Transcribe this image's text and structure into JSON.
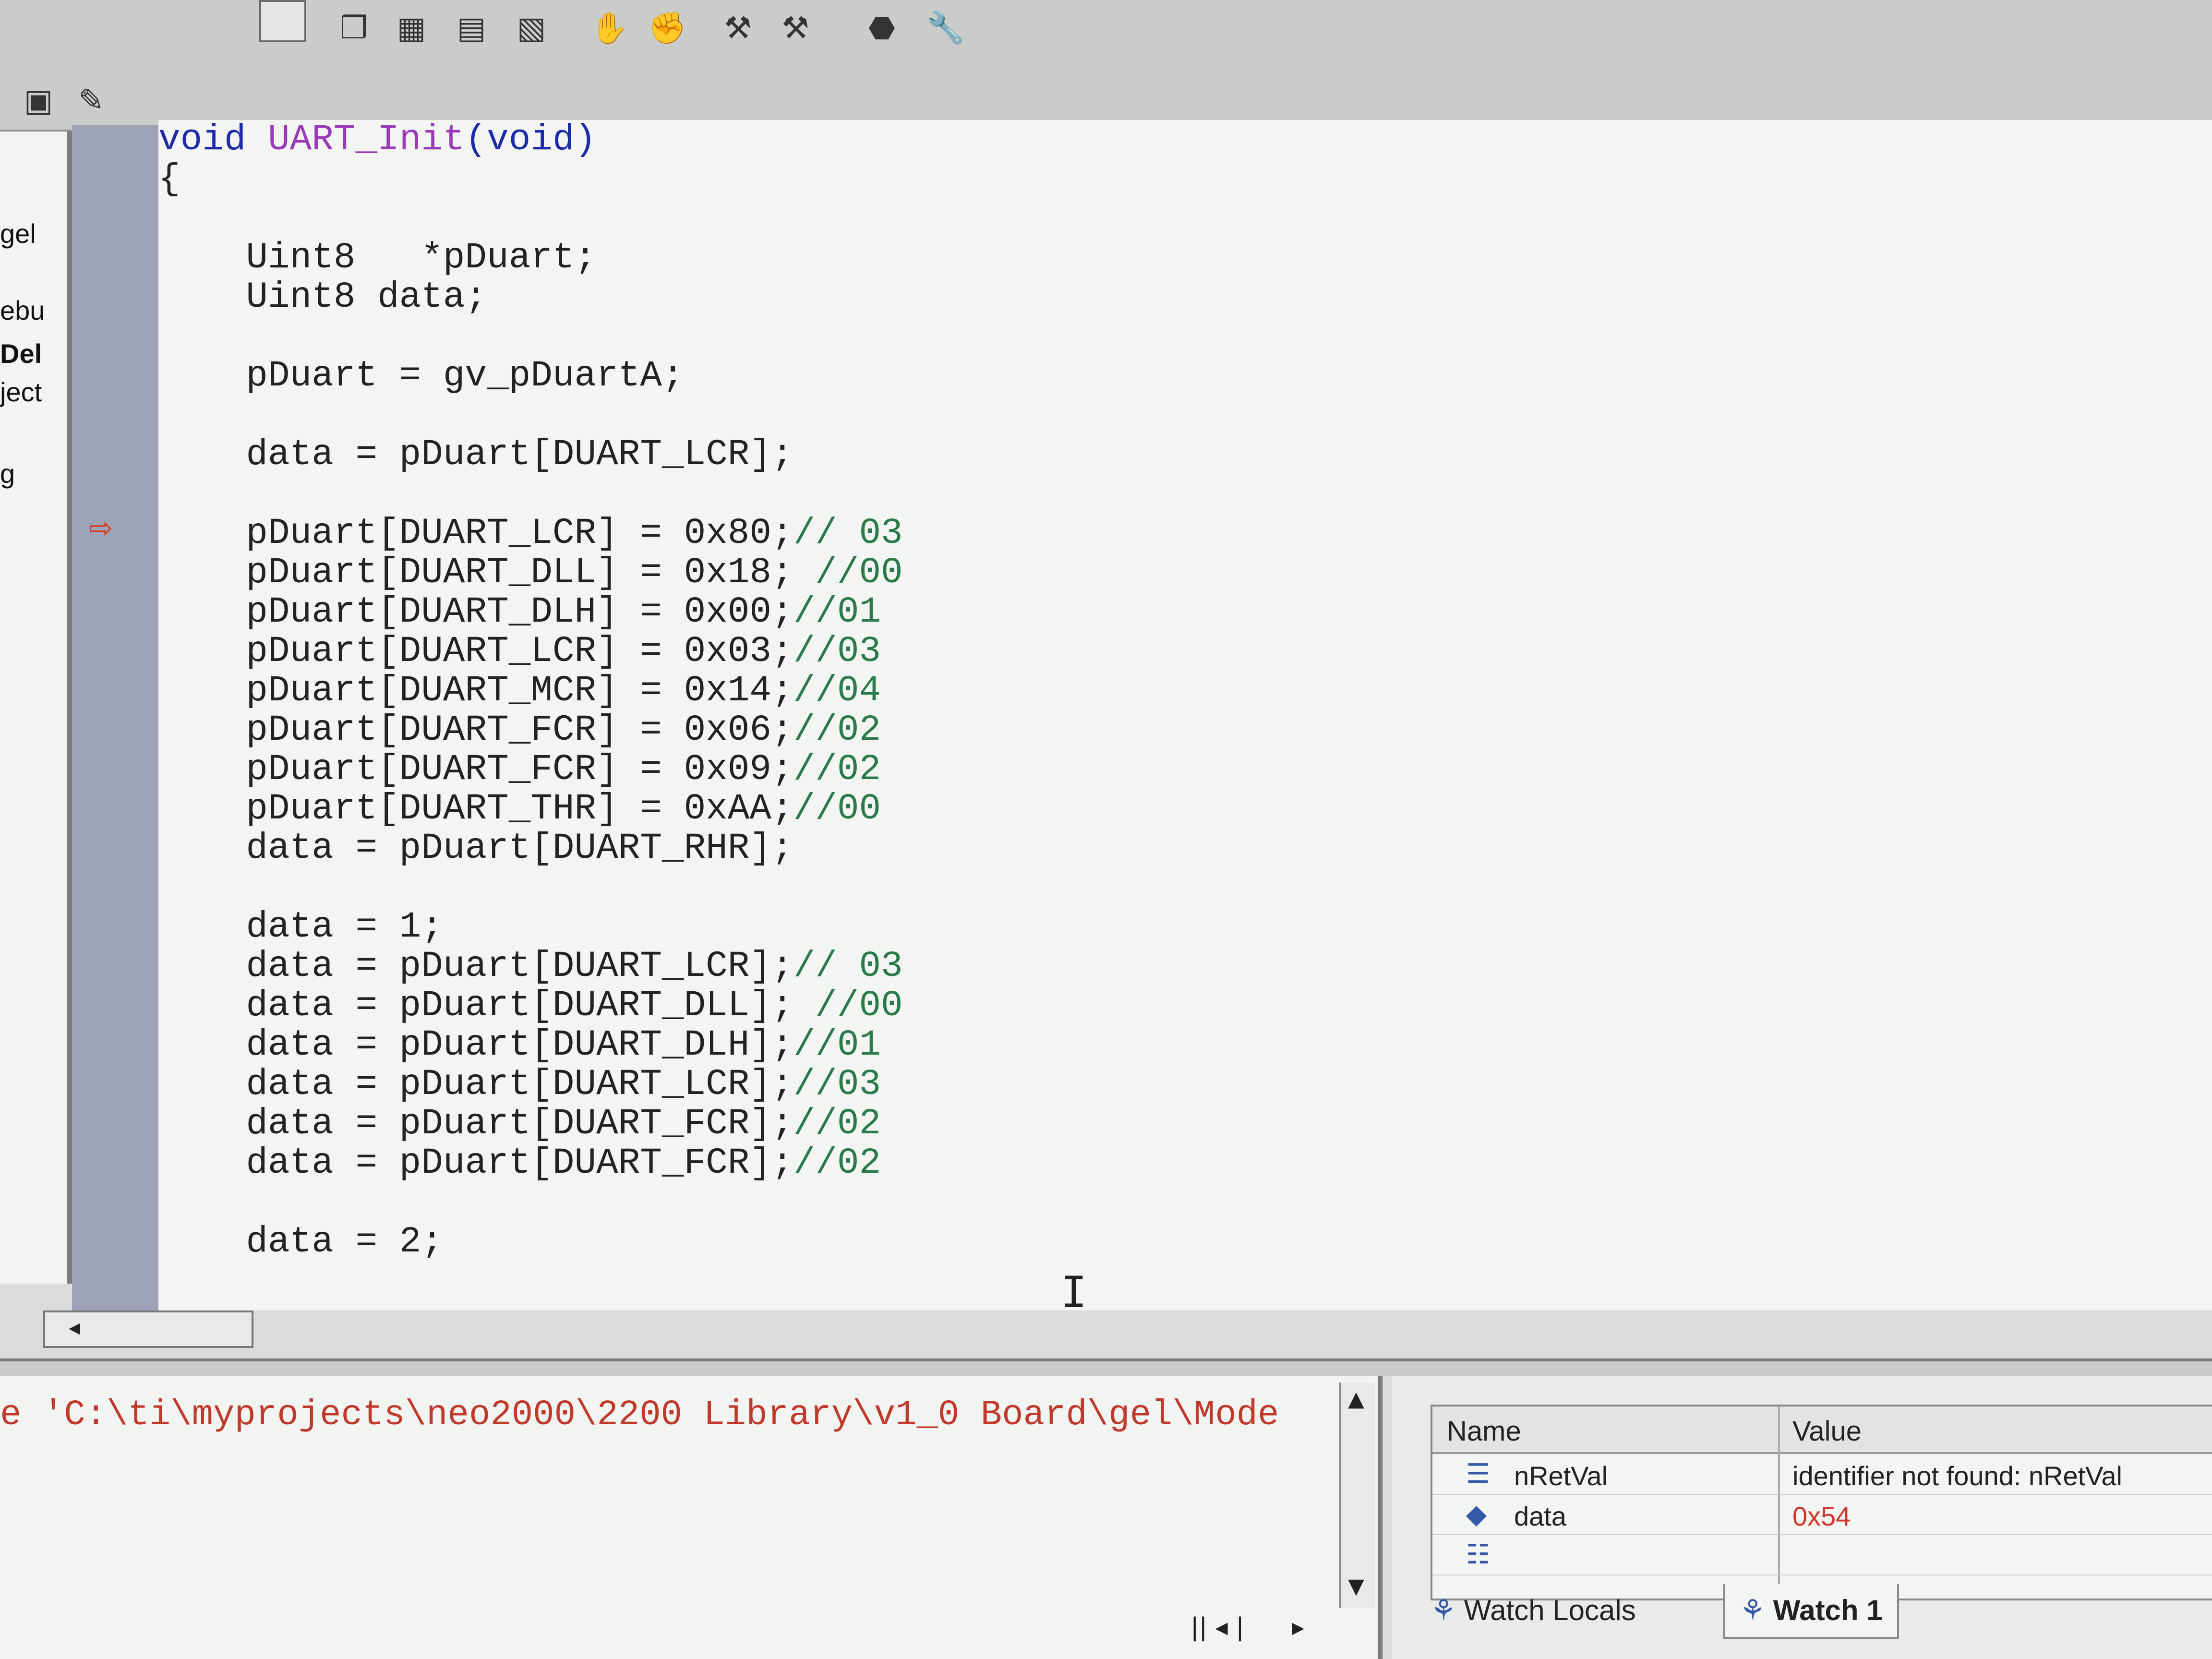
{
  "toolbar": {
    "icons": [
      "layers-icon",
      "grid-icon",
      "table-icon",
      "clear-icon",
      "halt-hand-icon",
      "run-icon",
      "step-icon",
      "step-over-icon",
      "stop-icon",
      "wrench-icon"
    ],
    "small_icons": [
      "monitor-icon",
      "edit-icon"
    ]
  },
  "left_pane": {
    "items": [
      "gel",
      "ebu",
      "Del",
      "ject",
      "g"
    ]
  },
  "editor": {
    "function_signature": {
      "return_type": "void",
      "name": "UART_Init",
      "params": "(void)"
    },
    "lines": [
      "{",
      "",
      "    Uint8   *pDuart;",
      "    Uint8 data;",
      "",
      "    pDuart = gv_pDuartA;",
      "",
      "    data = pDuart[DUART_LCR];",
      "",
      "    pDuart[DUART_LCR] = 0x80;// 03",
      "    pDuart[DUART_DLL] = 0x18; //00",
      "    pDuart[DUART_DLH] = 0x00;//01",
      "    pDuart[DUART_LCR] = 0x03;//03",
      "    pDuart[DUART_MCR] = 0x14;//04",
      "    pDuart[DUART_FCR] = 0x06;//02",
      "    pDuart[DUART_FCR] = 0x09;//02",
      "    pDuart[DUART_THR] = 0xAA;//00",
      "    data = pDuart[DUART_RHR];",
      "",
      "    data = 1;",
      "    data = pDuart[DUART_LCR];// 03",
      "    data = pDuart[DUART_DLL]; //00",
      "    data = pDuart[DUART_DLH];//01",
      "    data = pDuart[DUART_LCR];//03",
      "    data = pDuart[DUART_FCR];//02",
      "    data = pDuart[DUART_FCR];//02",
      "",
      "    data = 2;"
    ],
    "breakpoint_arrow": "⇨"
  },
  "output": {
    "text": "e 'C:\\ti\\myprojects\\neo2000\\2200 Library\\v1_0 Board\\gel\\Mode"
  },
  "watch": {
    "columns": [
      "Name",
      "Value"
    ],
    "rows": [
      {
        "icon": "array-icon",
        "glyph": "☰",
        "name": "nRetVal",
        "value": "identifier not found: nRetVal",
        "value_color": "#222222"
      },
      {
        "icon": "variable-icon",
        "glyph": "◆",
        "name": "data",
        "value": "0x54",
        "value_color": "#d0342b"
      },
      {
        "icon": "new-entry-icon",
        "glyph": "☷",
        "name": "",
        "value": "",
        "value_color": "#222222"
      }
    ],
    "tabs": [
      {
        "label": "Watch Locals",
        "glyph": "⚘",
        "active": false
      },
      {
        "label": "Watch 1",
        "glyph": "⚘",
        "active": true
      }
    ]
  }
}
